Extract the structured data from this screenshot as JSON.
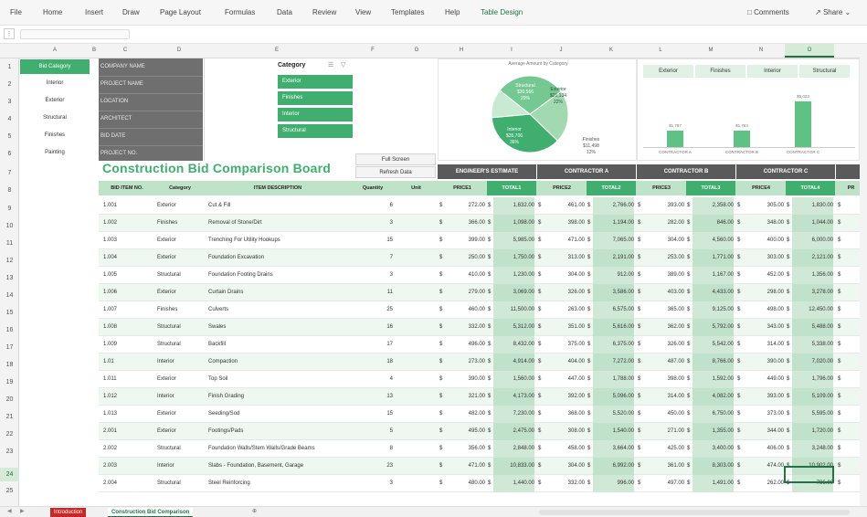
{
  "menu": {
    "items": [
      "File",
      "Home",
      "Insert",
      "Draw",
      "Page Layout",
      "Formulas",
      "Data",
      "Review",
      "View",
      "Templates",
      "Help",
      "Table Design"
    ],
    "comments": "Comments",
    "share": "Share"
  },
  "column_headers": [
    "A",
    "B",
    "C",
    "D",
    "E",
    "F",
    "G",
    "H",
    "I",
    "J",
    "K",
    "L",
    "M",
    "N",
    "O"
  ],
  "row_numbers": [
    "1",
    "2",
    "3",
    "4",
    "5",
    "6",
    "7",
    "8",
    "9",
    "10",
    "11",
    "12",
    "13",
    "14",
    "15",
    "16",
    "17",
    "18",
    "19",
    "20",
    "21",
    "22",
    "23",
    "24",
    "25"
  ],
  "left_slicer": [
    "Bid Category",
    "Interior",
    "Exterior",
    "Structural",
    "Finishes",
    "Painting"
  ],
  "info_labels": [
    "COMPANY NAME",
    "PROJECT NAME",
    "LOCATION",
    "ARCHITECT",
    "BID DATE",
    "PROJECT NO."
  ],
  "category_slicer": {
    "title": "Category",
    "items": [
      "Exterior",
      "Finishes",
      "Interior",
      "Structural"
    ]
  },
  "buttons": {
    "full_screen": "Full Screen",
    "refresh": "Refresh Data"
  },
  "title": "Construction Bid Comparison Board",
  "pie_chart": {
    "title": "Average Amount by Category",
    "labels": [
      {
        "name": "Structural",
        "value": "$30,566",
        "pct": "29%"
      },
      {
        "name": "Exterior",
        "value": "$21,134",
        "pct": "22%"
      },
      {
        "name": "Interior",
        "value": "$35,706",
        "pct": "36%"
      },
      {
        "name": "Finishes",
        "value": "$11,498",
        "pct": "12%"
      }
    ]
  },
  "bar_chart": {
    "tabs": [
      "Exterior",
      "Finishes",
      "Interior",
      "Structural"
    ],
    "bars": [
      {
        "label": "CONTRACTOR A",
        "value": "$1,787"
      },
      {
        "label": "CONTRACTOR B",
        "value": "$1,763"
      },
      {
        "label": "CONTRACTOR C",
        "value": "$5,023"
      }
    ]
  },
  "chart_data": [
    {
      "type": "pie",
      "title": "Average Amount by Category",
      "categories": [
        "Structural",
        "Exterior",
        "Interior",
        "Finishes"
      ],
      "values": [
        29,
        22,
        36,
        12
      ],
      "colors": [
        "#76c893",
        "#a3d9b1",
        "#3fae6e",
        "#c8e9d2"
      ]
    },
    {
      "type": "bar",
      "categories": [
        "CONTRACTOR A",
        "CONTRACTOR B",
        "CONTRACTOR C"
      ],
      "values": [
        1787,
        1763,
        5023
      ],
      "ylim": [
        0,
        6000
      ]
    }
  ],
  "groups": [
    "ENGINEER'S ESTIMATE",
    "CONTRACTOR A",
    "CONTRACTOR B",
    "CONTRACTOR C"
  ],
  "headers": [
    "BID ITEM NO.",
    "Category",
    "ITEM DESCRIPTION",
    "Quantity",
    "Unit",
    "PRICE1",
    "TOTAL1",
    "PRICE2",
    "TOTAL2",
    "PRICE3",
    "TOTAL3",
    "PRICE4",
    "TOTAL4",
    "PR"
  ],
  "rows": [
    [
      "1.001",
      "Exterior",
      "Cut & Fill",
      "6",
      "",
      "272.00",
      "1,632.00",
      "461.00",
      "2,766.00",
      "393.00",
      "2,358.00",
      "305.00",
      "1,830.00"
    ],
    [
      "1.002",
      "Finishes",
      "Removal of Stone/Dirt",
      "3",
      "",
      "366.00",
      "1,098.00",
      "398.00",
      "1,194.00",
      "282.00",
      "846.00",
      "348.00",
      "1,044.00"
    ],
    [
      "1.003",
      "Exterior",
      "Trenching For Utility Hookups",
      "15",
      "",
      "399.00",
      "5,985.00",
      "471.00",
      "7,065.00",
      "304.00",
      "4,560.00",
      "400.00",
      "6,000.00"
    ],
    [
      "1.004",
      "Exterior",
      "Foundation Excavation",
      "7",
      "",
      "250.00",
      "1,750.00",
      "313.00",
      "2,191.00",
      "253.00",
      "1,771.00",
      "303.00",
      "2,121.00"
    ],
    [
      "1.005",
      "Structural",
      "Foundation Footing Drains",
      "3",
      "",
      "410.00",
      "1,230.00",
      "304.00",
      "912.00",
      "389.00",
      "1,167.00",
      "452.00",
      "1,356.00"
    ],
    [
      "1.006",
      "Exterior",
      "Curtain Drains",
      "11",
      "",
      "279.00",
      "3,069.00",
      "326.00",
      "3,586.00",
      "403.00",
      "4,433.00",
      "298.00",
      "3,278.00"
    ],
    [
      "1.007",
      "Finishes",
      "Culverts",
      "25",
      "",
      "460.00",
      "11,500.00",
      "263.00",
      "6,575.00",
      "365.00",
      "9,125.00",
      "498.00",
      "12,450.00"
    ],
    [
      "1.008",
      "Structural",
      "Swales",
      "16",
      "",
      "332.00",
      "5,312.00",
      "351.00",
      "5,616.00",
      "362.00",
      "5,792.00",
      "343.00",
      "5,488.00"
    ],
    [
      "1.009",
      "Structural",
      "Backfill",
      "17",
      "",
      "496.00",
      "8,432.00",
      "375.00",
      "6,375.00",
      "326.00",
      "5,542.00",
      "314.00",
      "5,338.00"
    ],
    [
      "1.01",
      "Interior",
      "Compaction",
      "18",
      "",
      "273.00",
      "4,914.00",
      "404.00",
      "7,272.00",
      "487.00",
      "8,766.00",
      "390.00",
      "7,020.00"
    ],
    [
      "1.011",
      "Exterior",
      "Top Soil",
      "4",
      "",
      "390.00",
      "1,560.00",
      "447.00",
      "1,788.00",
      "398.00",
      "1,592.00",
      "449.00",
      "1,796.00"
    ],
    [
      "1.012",
      "Interior",
      "Finish Grading",
      "13",
      "",
      "321.00",
      "4,173.00",
      "392.00",
      "5,096.00",
      "314.00",
      "4,082.00",
      "393.00",
      "5,109.00"
    ],
    [
      "1.013",
      "Exterior",
      "Seeding/Sod",
      "15",
      "",
      "482.00",
      "7,230.00",
      "368.00",
      "5,520.00",
      "450.00",
      "6,750.00",
      "373.00",
      "5,595.00"
    ],
    [
      "2.001",
      "Exterior",
      "Footings/Pads",
      "5",
      "",
      "495.00",
      "2,475.00",
      "308.00",
      "1,540.00",
      "271.00",
      "1,355.00",
      "344.00",
      "1,720.00"
    ],
    [
      "2.002",
      "Structural",
      "Foundation Walls/Stem Walls/Grade Beams",
      "8",
      "",
      "356.00",
      "2,848.00",
      "458.00",
      "3,664.00",
      "425.00",
      "3,400.00",
      "406.00",
      "3,248.00"
    ],
    [
      "2.003",
      "Interior",
      "Slabs - Foundation, Basement, Garage",
      "23",
      "",
      "471.00",
      "10,833.00",
      "304.00",
      "6,992.00",
      "361.00",
      "8,303.00",
      "474.00",
      "10,902.00"
    ],
    [
      "2.004",
      "Structural",
      "Steel Reinforcing",
      "3",
      "",
      "480.00",
      "1,440.00",
      "332.00",
      "996.00",
      "497.00",
      "1,491.00",
      "262.00",
      "786.00"
    ]
  ],
  "sheet_tabs": [
    "Introduction",
    "Construction Bid Comparison"
  ]
}
